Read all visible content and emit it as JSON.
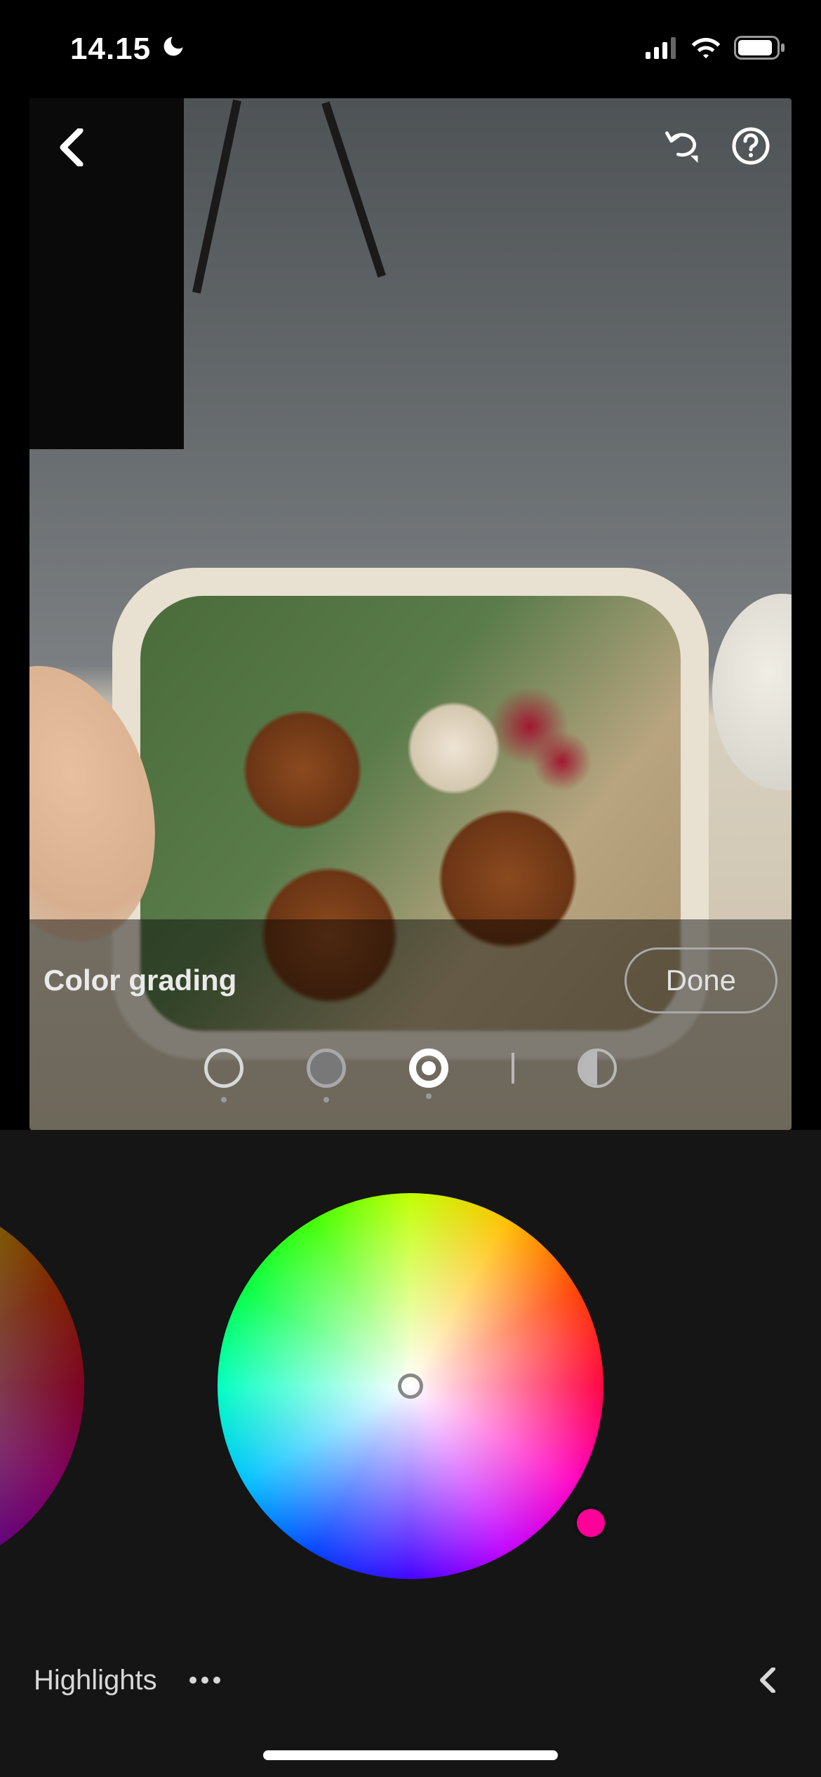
{
  "status": {
    "time": "14.15",
    "dnd_icon": "moon-icon",
    "signal_icon": "cell-signal-icon",
    "wifi_icon": "wifi-icon",
    "battery_icon": "battery-icon"
  },
  "toolbar": {
    "back_icon": "chevron-left-icon",
    "undo_icon": "undo-icon",
    "help_icon": "help-icon"
  },
  "panel": {
    "title": "Color grading",
    "done_label": "Done"
  },
  "ranges": {
    "shadows": "Shadows",
    "midtones": "Midtones",
    "highlights": "Highlights",
    "global": "Global",
    "active": "highlights"
  },
  "color_wheel": {
    "selected_hue": 325,
    "selected_saturation": 0,
    "handle_color": "#ff0099"
  },
  "slider": {
    "label": "Highlights",
    "more_icon": "ellipsis-icon",
    "collapse_icon": "chevron-right-icon"
  }
}
